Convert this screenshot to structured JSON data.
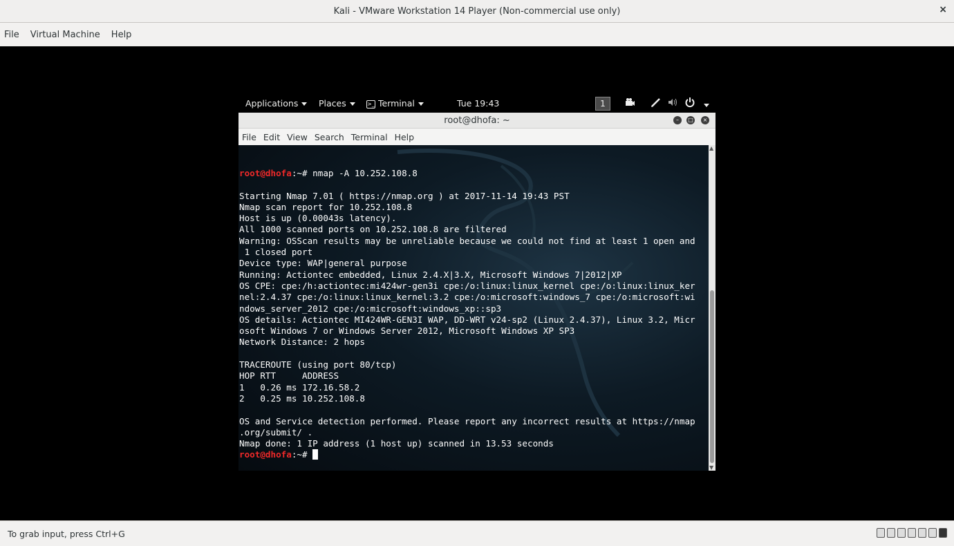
{
  "window": {
    "title": "Kali - VMware Workstation 14 Player (Non-commercial use only)",
    "close_glyph": "×"
  },
  "menubar": {
    "items": [
      "File",
      "Virtual Machine",
      "Help"
    ]
  },
  "gnome_panel": {
    "applications": "Applications",
    "places": "Places",
    "terminal": "Terminal",
    "terminal_icon_glyph": ">_",
    "clock": "Tue 19:43",
    "workspace": "1"
  },
  "terminal": {
    "title": "root@dhofa: ~",
    "menu": [
      "File",
      "Edit",
      "View",
      "Search",
      "Terminal",
      "Help"
    ],
    "prompt_user": "root@dhofa",
    "prompt_path": ":~# ",
    "command": "nmap -A 10.252.108.8",
    "output_lines": [
      "",
      "Starting Nmap 7.01 ( https://nmap.org ) at 2017-11-14 19:43 PST",
      "Nmap scan report for 10.252.108.8",
      "Host is up (0.00043s latency).",
      "All 1000 scanned ports on 10.252.108.8 are filtered",
      "Warning: OSScan results may be unreliable because we could not find at least 1 open and",
      " 1 closed port",
      "Device type: WAP|general purpose",
      "Running: Actiontec embedded, Linux 2.4.X|3.X, Microsoft Windows 7|2012|XP",
      "OS CPE: cpe:/h:actiontec:mi424wr-gen3i cpe:/o:linux:linux_kernel cpe:/o:linux:linux_ker",
      "nel:2.4.37 cpe:/o:linux:linux_kernel:3.2 cpe:/o:microsoft:windows_7 cpe:/o:microsoft:wi",
      "ndows_server_2012 cpe:/o:microsoft:windows_xp::sp3",
      "OS details: Actiontec MI424WR-GEN3I WAP, DD-WRT v24-sp2 (Linux 2.4.37), Linux 3.2, Micr",
      "osoft Windows 7 or Windows Server 2012, Microsoft Windows XP SP3",
      "Network Distance: 2 hops",
      "",
      "TRACEROUTE (using port 80/tcp)",
      "HOP RTT     ADDRESS",
      "1   0.26 ms 172.16.58.2",
      "2   0.25 ms 10.252.108.8",
      "",
      "OS and Service detection performed. Please report any incorrect results at https://nmap",
      ".org/submit/ .",
      "Nmap done: 1 IP address (1 host up) scanned in 13.53 seconds"
    ],
    "final_prompt_user": "root@dhofa",
    "final_prompt_path": ":~# "
  },
  "statusbar": {
    "hint": "To grab input, press Ctrl+G"
  },
  "colors": {
    "prompt_user": "#ef2929",
    "terminal_bg": "#0d1a24",
    "vm_bg": "#000000"
  }
}
